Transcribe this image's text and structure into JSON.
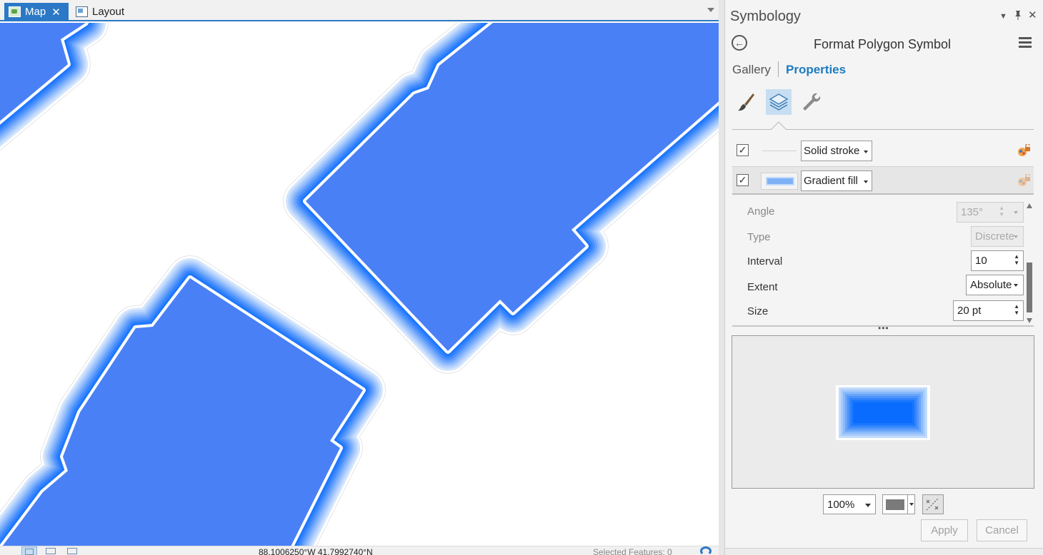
{
  "document_tabs": [
    {
      "label": "Map",
      "active": true
    },
    {
      "label": "Layout",
      "active": false
    }
  ],
  "map": {
    "fill_color": "#4a80f5",
    "halo_color": "#1a73ff",
    "status_coordinates": "88.1006250°W 41.7992740°N",
    "selected_features": "Selected Features: 0"
  },
  "pane": {
    "title": "Symbology",
    "format_title": "Format Polygon Symbol",
    "tabs": {
      "gallery": "Gallery",
      "properties": "Properties"
    },
    "active_tab": "Properties",
    "tool_tabs": [
      "paintbrush-icon",
      "layers-icon",
      "wrench-icon"
    ],
    "layers": [
      {
        "label": "Solid stroke",
        "checked": true
      },
      {
        "label": "Gradient fill",
        "checked": true,
        "selected": true
      }
    ],
    "properties": {
      "angle": {
        "label": "Angle",
        "value": "135°",
        "enabled": false
      },
      "type": {
        "label": "Type",
        "value": "Discrete",
        "enabled": false
      },
      "interval": {
        "label": "Interval",
        "value": "10"
      },
      "extent": {
        "label": "Extent",
        "value": "Absolute"
      },
      "size": {
        "label": "Size",
        "value": "20 pt"
      }
    },
    "preview": {
      "zoom": "100%",
      "background_color": "#7a7a7a"
    },
    "buttons": {
      "apply": "Apply",
      "cancel": "Cancel"
    }
  },
  "accent_color": "#1c7bc1"
}
